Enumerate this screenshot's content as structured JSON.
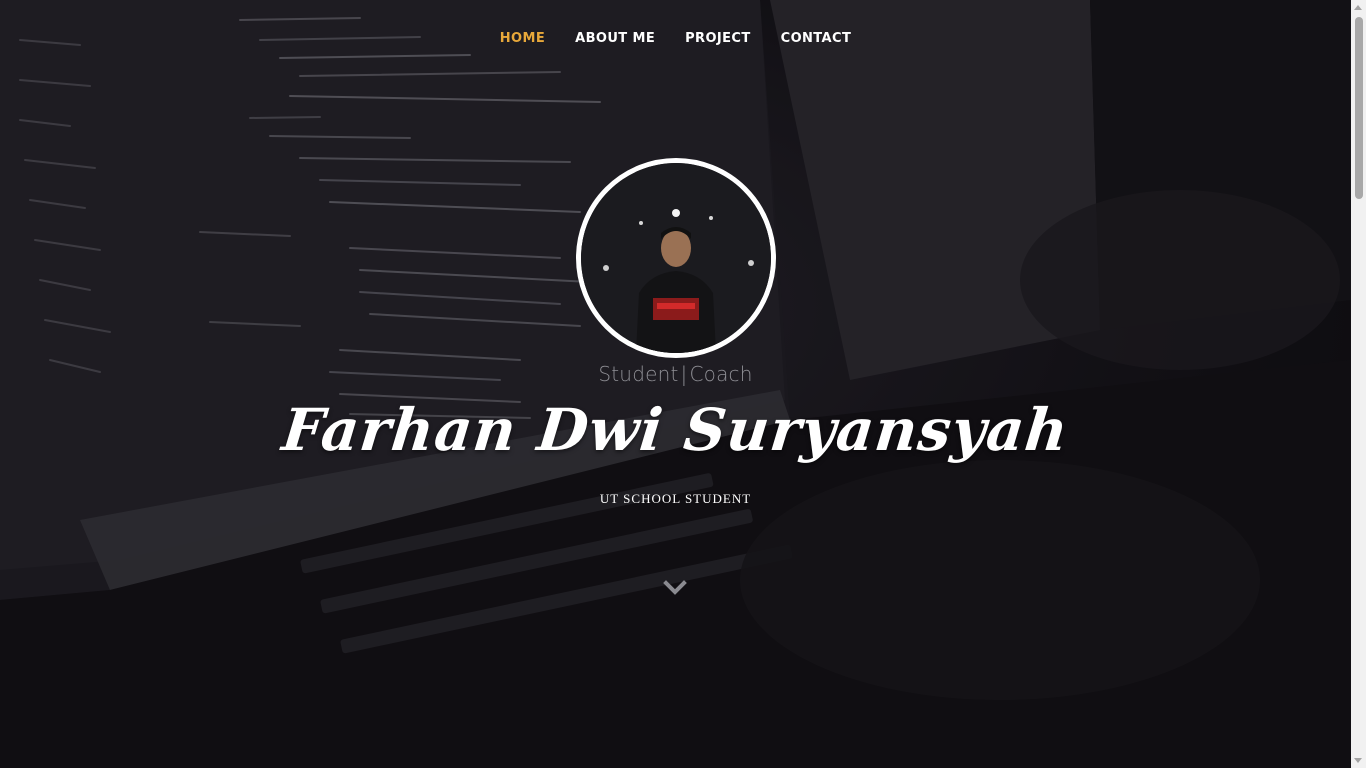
{
  "nav": {
    "items": [
      {
        "label": "HOME",
        "active": true
      },
      {
        "label": "ABOUT ME",
        "active": false
      },
      {
        "label": "PROJECT",
        "active": false
      },
      {
        "label": "CONTACT",
        "active": false
      }
    ]
  },
  "hero": {
    "roles": [
      "Student",
      "Coach"
    ],
    "role_separator": "|",
    "name": "Farhan Dwi Suryansyah",
    "tagline": "UT SCHOOL STUDENT",
    "scroll_icon": "chevron-down-icon"
  },
  "colors": {
    "accent": "#e8a83a",
    "nav_text": "#ffffff",
    "role_text": "#8f8f95",
    "avatar_border": "#ffffff"
  }
}
